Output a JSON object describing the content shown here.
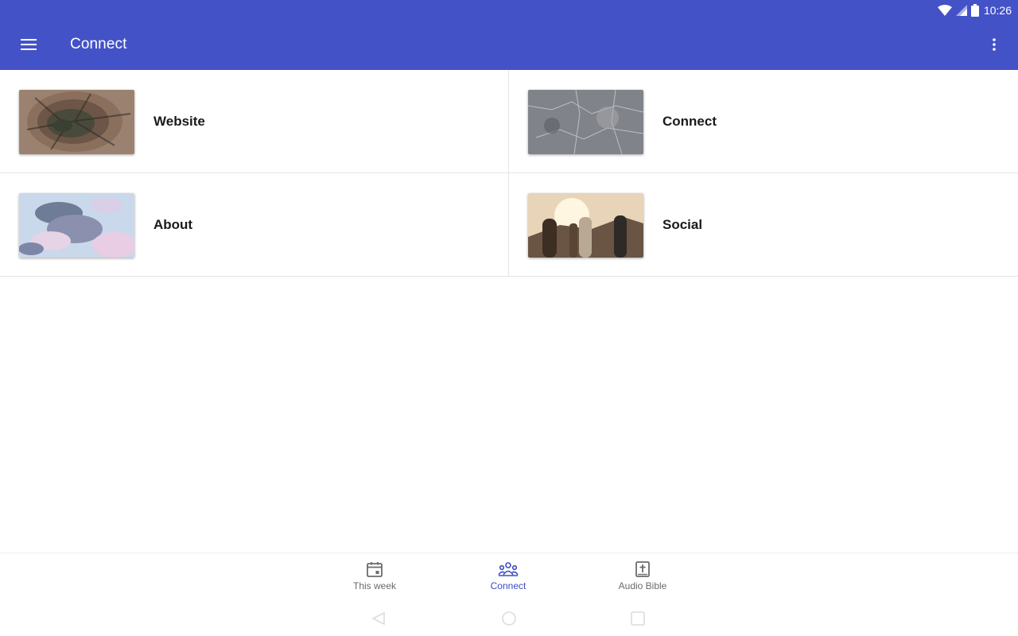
{
  "status": {
    "time": "10:26",
    "wifi_icon": "wifi-icon",
    "signal_icon": "signal-icon",
    "battery_icon": "battery-icon"
  },
  "appbar": {
    "title": "Connect",
    "menu_icon": "hamburger-menu-icon",
    "more_icon": "more-vert-icon",
    "color": "#4452c8"
  },
  "tiles": [
    {
      "label": "Website",
      "image": "wood-grain"
    },
    {
      "label": "Connect",
      "image": "stone-texture"
    },
    {
      "label": "About",
      "image": "clouds-sky"
    },
    {
      "label": "Social",
      "image": "people-sunset"
    }
  ],
  "bottom_nav": {
    "items": [
      {
        "label": "This week",
        "icon": "calendar-icon",
        "active": false
      },
      {
        "label": "Connect",
        "icon": "people-group-icon",
        "active": true
      },
      {
        "label": "Audio Bible",
        "icon": "bible-icon",
        "active": false
      }
    ],
    "active_color": "#3d4bc4"
  },
  "system_nav": {
    "back_icon": "back-icon",
    "home_icon": "home-icon",
    "recents_icon": "recents-icon"
  }
}
